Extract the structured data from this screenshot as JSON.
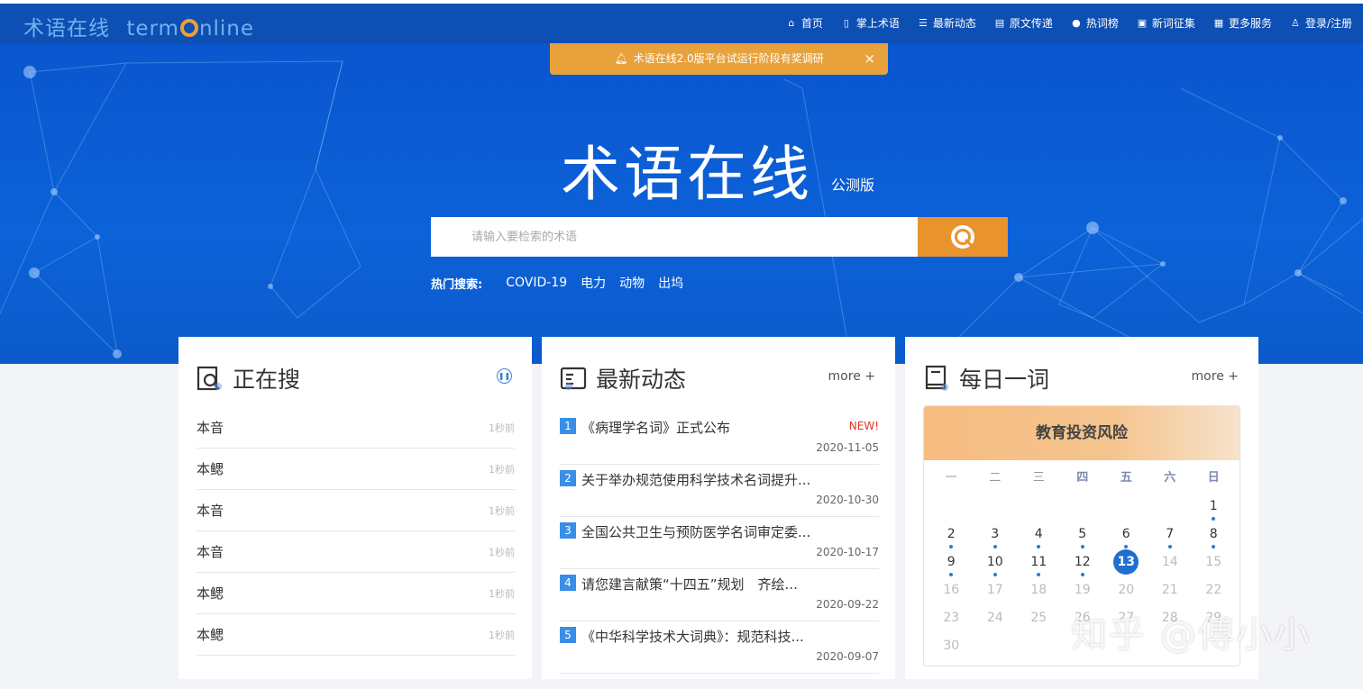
{
  "brand": {
    "logo_cn": "术语在线",
    "logo_en_pre": "term",
    "logo_en_post": "nline"
  },
  "nav": {
    "items": [
      {
        "label": "首页",
        "icon": "home-icon"
      },
      {
        "label": "掌上术语",
        "icon": "mobile-icon"
      },
      {
        "label": "最新动态",
        "icon": "news-icon"
      },
      {
        "label": "原文传递",
        "icon": "document-icon"
      },
      {
        "label": "热词榜",
        "icon": "flame-icon"
      },
      {
        "label": "新词征集",
        "icon": "collect-icon"
      },
      {
        "label": "更多服务",
        "icon": "grid-icon"
      },
      {
        "label": "登录/注册",
        "icon": "user-icon"
      }
    ]
  },
  "notice": {
    "text": "术语在线2.0版平台试运行阶段有奖调研",
    "close": "×"
  },
  "hero": {
    "title": "术语在线",
    "badge": "公测版"
  },
  "search": {
    "placeholder": "请输入要检索的术语"
  },
  "hot": {
    "label": "热门搜索:",
    "tags": [
      "COVID-19",
      "电力",
      "动物",
      "出坞"
    ]
  },
  "searching": {
    "title": "正在搜",
    "rows": [
      {
        "term": "本音",
        "time": "1秒前"
      },
      {
        "term": "本鳃",
        "time": "1秒前"
      },
      {
        "term": "本音",
        "time": "1秒前"
      },
      {
        "term": "本音",
        "time": "1秒前"
      },
      {
        "term": "本鳃",
        "time": "1秒前"
      },
      {
        "term": "本鳃",
        "time": "1秒前"
      }
    ]
  },
  "news": {
    "title": "最新动态",
    "more": "more +",
    "items": [
      {
        "num": "1",
        "title": "《病理学名词》正式公布",
        "date": "2020-11-05",
        "badge": "NEW!"
      },
      {
        "num": "2",
        "title": "关于举办规范使用科学技术名词提升...",
        "date": "2020-10-30"
      },
      {
        "num": "3",
        "title": "全国公共卫生与预防医学名词审定委...",
        "date": "2020-10-17"
      },
      {
        "num": "4",
        "title": "请您建言献策“十四五”规划　齐绘...",
        "date": "2020-09-22"
      },
      {
        "num": "5",
        "title": "《中华科学技术大词典》：规范科技...",
        "date": "2020-09-07"
      }
    ]
  },
  "daily": {
    "title": "每日一词",
    "more": "more +",
    "word": "教育投资风险",
    "weekdays": [
      "一",
      "二",
      "三",
      "四",
      "五",
      "六",
      "日"
    ],
    "weekdays_bold": [
      false,
      false,
      false,
      true,
      true,
      true,
      true
    ],
    "weeks": [
      [
        "",
        "",
        "",
        "",
        "",
        "",
        "1"
      ],
      [
        "2",
        "3",
        "4",
        "5",
        "6",
        "7",
        "8"
      ],
      [
        "9",
        "10",
        "11",
        "12",
        "13",
        "14",
        "15"
      ],
      [
        "16",
        "17",
        "18",
        "19",
        "20",
        "21",
        "22"
      ],
      [
        "23",
        "24",
        "25",
        "26",
        "27",
        "28",
        "29"
      ],
      [
        "30",
        "",
        "",
        "",
        "",
        "",
        ""
      ]
    ],
    "today": "13",
    "dotted_days": [
      "1",
      "2",
      "3",
      "4",
      "5",
      "6",
      "7",
      "8",
      "9",
      "10",
      "11",
      "12"
    ]
  },
  "watermark": "知乎 @傅小小",
  "colors": {
    "nav_bg": "#0d4fb3",
    "hero_bg": "#0a56cf",
    "accent_orange": "#e8932d",
    "notice_bg": "#e8a23b",
    "today_blue": "#1f6fd0"
  }
}
